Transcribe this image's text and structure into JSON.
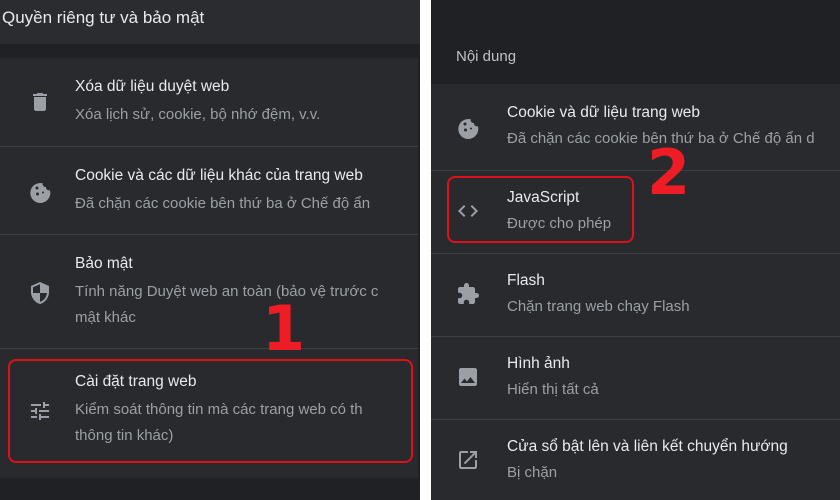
{
  "left": {
    "title": "Quyền riêng tư và bảo mật",
    "items": [
      {
        "icon": "trash-icon",
        "title": "Xóa dữ liệu duyệt web",
        "sub1": "Xóa lịch sử, cookie, bộ nhớ đệm, v.v.",
        "sub2": ""
      },
      {
        "icon": "cookie-icon",
        "title": "Cookie và các dữ liệu khác của trang web",
        "sub1": "Đã chặn các cookie bên thứ ba ở Chế độ ẩn",
        "sub2": ""
      },
      {
        "icon": "shield-icon",
        "title": "Bảo mật",
        "sub1": "Tính năng Duyệt web an toàn (bảo vệ trước c",
        "sub2": "mật khác"
      },
      {
        "icon": "tune-icon",
        "title": "Cài đặt trang web",
        "sub1": "Kiểm soát thông tin mà các trang web có th",
        "sub2": "thông tin khác)"
      }
    ]
  },
  "right": {
    "label": "Nội dung",
    "items": [
      {
        "icon": "cookie-icon",
        "title": "Cookie và dữ liệu trang web",
        "sub": "Đã chặn các cookie bên thứ ba ở Chế độ ẩn d"
      },
      {
        "icon": "code-icon",
        "title": "JavaScript",
        "sub": "Được cho phép"
      },
      {
        "icon": "puzzle-icon",
        "title": "Flash",
        "sub": "Chặn trang web chạy Flash"
      },
      {
        "icon": "image-icon",
        "title": "Hình ảnh",
        "sub": "Hiển thị tất cả"
      },
      {
        "icon": "open-in-new-icon",
        "title": "Cửa sổ bật lên và liên kết chuyển hướng",
        "sub": "Bị chặn"
      }
    ]
  },
  "annotations": {
    "step1": "1",
    "step2": "2",
    "callout_color": "#e0101a"
  },
  "colors": {
    "background": "#202124",
    "card": "#292a2d",
    "text_primary": "#e8eaed",
    "text_secondary": "#9aa0a6"
  }
}
